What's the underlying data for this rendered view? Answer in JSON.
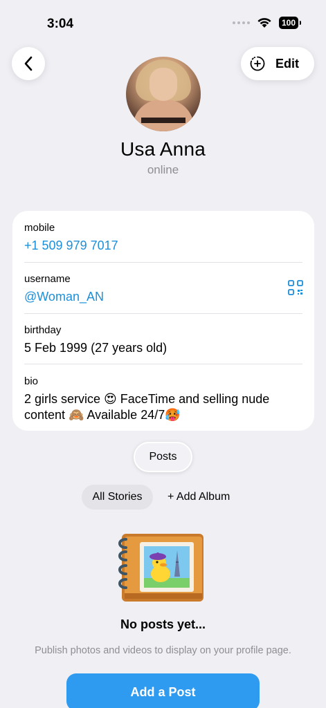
{
  "status_bar": {
    "time": "3:04",
    "battery": "100"
  },
  "nav": {
    "edit_label": "Edit"
  },
  "profile": {
    "name": "Usa Anna",
    "status": "online"
  },
  "info": {
    "mobile_label": "mobile",
    "mobile_value": "+1 509 979 7017",
    "username_label": "username",
    "username_value": "@Woman_AN",
    "birthday_label": "birthday",
    "birthday_value": "5 Feb 1999 (27 years old)",
    "bio_label": "bio",
    "bio_value": "2 girls service 😍 FaceTime and selling nude content 🙈 Available 24/7🥵"
  },
  "tabs": {
    "posts_label": "Posts"
  },
  "albums": {
    "all_stories_label": "All Stories",
    "add_album_label": "+ Add Album"
  },
  "empty_state": {
    "title": "No posts yet...",
    "description": "Publish photos and videos to display on your profile page.",
    "button_label": "Add a Post"
  },
  "colors": {
    "link": "#1d8fd9",
    "accent_button": "#2f9bf0",
    "background": "#efeff4"
  }
}
